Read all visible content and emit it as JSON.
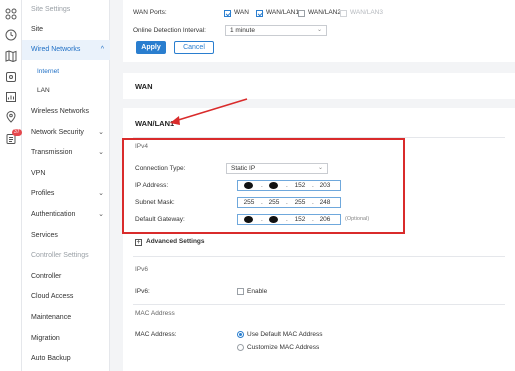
{
  "rail": {
    "badge": "37",
    "icons": [
      "grid-icon",
      "clock-icon",
      "map-icon",
      "device-icon",
      "chart-icon",
      "location-icon",
      "log-icon"
    ]
  },
  "sidebar": {
    "items": [
      {
        "label": "Site Settings"
      },
      {
        "label": "Site"
      },
      {
        "label": "Wired Networks"
      },
      {
        "label": "Internet"
      },
      {
        "label": "LAN"
      },
      {
        "label": "Wireless Networks"
      },
      {
        "label": "Network Security"
      },
      {
        "label": "Transmission"
      },
      {
        "label": "VPN"
      },
      {
        "label": "Profiles"
      },
      {
        "label": "Authentication"
      },
      {
        "label": "Services"
      },
      {
        "label": "Controller Settings"
      },
      {
        "label": "Controller"
      },
      {
        "label": "Cloud Access"
      },
      {
        "label": "Maintenance"
      },
      {
        "label": "Migration"
      },
      {
        "label": "Auto Backup"
      }
    ]
  },
  "top": {
    "wan_ports_label": "WAN Ports:",
    "ports": [
      {
        "label": "WAN",
        "checked": true,
        "disabled": false
      },
      {
        "label": "WAN/LAN1",
        "checked": true,
        "disabled": false
      },
      {
        "label": "WAN/LAN2",
        "checked": false,
        "disabled": false
      },
      {
        "label": "WAN/LAN3",
        "checked": false,
        "disabled": true
      }
    ],
    "online_detection_label": "Online Detection Interval:",
    "online_detection_value": "1 minute",
    "apply": "Apply",
    "cancel": "Cancel"
  },
  "wan": {
    "title": "WAN"
  },
  "wanlan1": {
    "title": "WAN/LAN1",
    "ipv4": "IPv4",
    "connection_type_label": "Connection Type:",
    "connection_type_value": "Static IP",
    "ip_label": "IP Address:",
    "ip": [
      "",
      "",
      "152",
      "203"
    ],
    "mask_label": "Subnet Mask:",
    "mask": [
      "255",
      "255",
      "255",
      "248"
    ],
    "gateway_label": "Default Gateway:",
    "gateway": [
      "",
      "",
      "152",
      "206"
    ],
    "optional": "(Optional)",
    "advanced": "Advanced Settings",
    "ipv6": "IPv6",
    "ipv6_label": "IPv6:",
    "enable": "Enable",
    "mac_section": "MAC Address",
    "mac_label": "MAC Address:",
    "mac_default": "Use Default MAC Address",
    "mac_custom": "Customize MAC Address"
  },
  "colors": {
    "accent": "#2a7ecf",
    "highlight": "#d92b2b"
  }
}
